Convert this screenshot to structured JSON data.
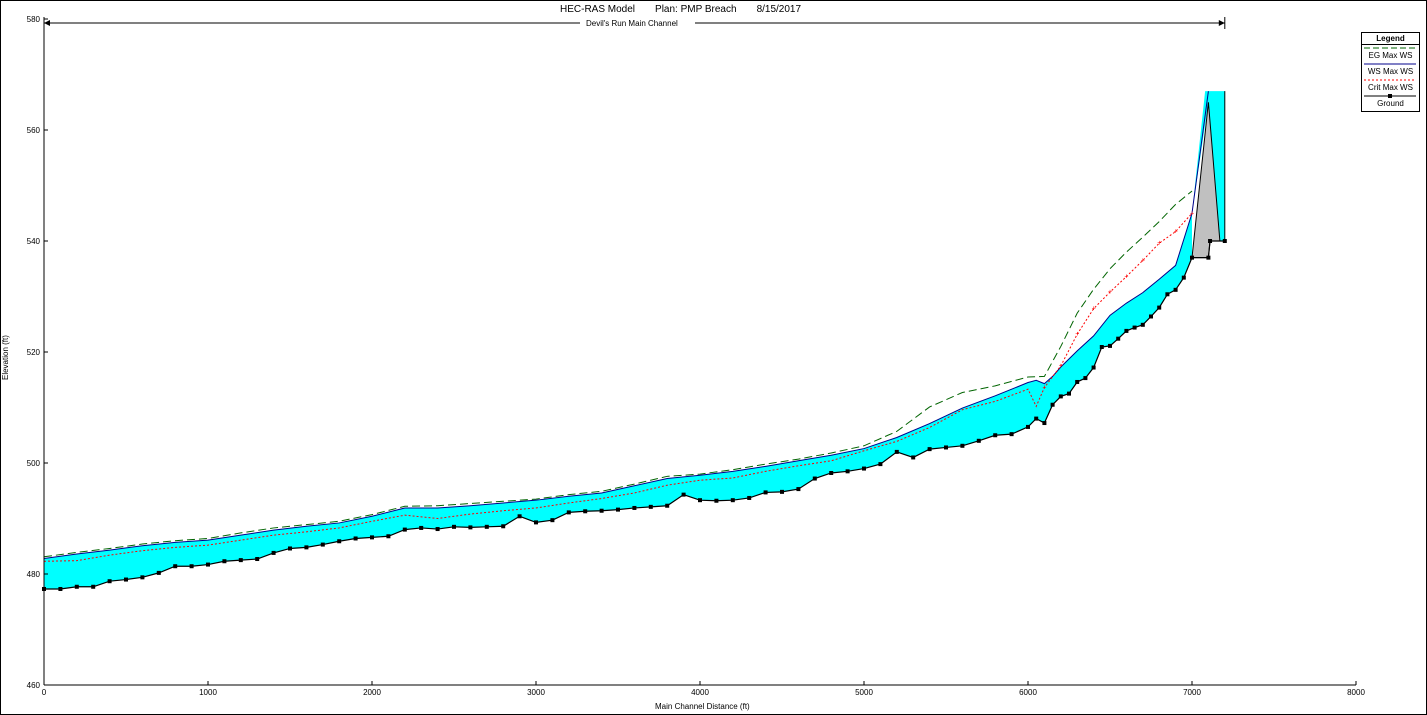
{
  "header": {
    "model": "HEC-RAS Model",
    "plan": "Plan: PMP Breach",
    "date": "8/15/2017",
    "reach": "Devil's Run Main Channel"
  },
  "legend": {
    "title": "Legend",
    "items": [
      {
        "label": "EG  Max WS",
        "color": "#006400",
        "style": "dashed"
      },
      {
        "label": "WS  Max WS",
        "color": "#00008b",
        "style": "solid"
      },
      {
        "label": "Crit  Max WS",
        "color": "#ff0000",
        "style": "dotted"
      },
      {
        "label": "Ground",
        "color": "#000000",
        "style": "solid-markers"
      }
    ]
  },
  "colors": {
    "water": "#00ffff",
    "structure": "#c0c0c0"
  },
  "chart_data": {
    "type": "line",
    "xlabel": "Main Channel Distance (ft)",
    "ylabel": "Elevation (ft)",
    "xlim": [
      0,
      8000
    ],
    "ylim": [
      460,
      580
    ],
    "xticks": [
      0,
      1000,
      2000,
      3000,
      4000,
      5000,
      6000,
      7000,
      8000
    ],
    "yticks": [
      460,
      480,
      500,
      520,
      540,
      560,
      580
    ],
    "grid": false,
    "legend_position": "top-right",
    "reach_extent": [
      0,
      7200
    ],
    "structure": {
      "type": "dam",
      "x": [
        7000,
        7200
      ],
      "crest": 567,
      "top_wall": [
        7100,
        567
      ]
    },
    "series": [
      {
        "name": "Ground",
        "x": [
          0,
          100,
          200,
          300,
          400,
          500,
          600,
          700,
          800,
          900,
          1000,
          1100,
          1200,
          1300,
          1400,
          1500,
          1600,
          1700,
          1800,
          1900,
          2000,
          2100,
          2200,
          2300,
          2400,
          2500,
          2600,
          2700,
          2800,
          2900,
          3000,
          3100,
          3200,
          3300,
          3400,
          3500,
          3600,
          3700,
          3800,
          3900,
          4000,
          4100,
          4200,
          4300,
          4400,
          4500,
          4600,
          4700,
          4800,
          4900,
          5000,
          5100,
          5200,
          5300,
          5400,
          5500,
          5600,
          5700,
          5800,
          5900,
          6000,
          6050,
          6100,
          6150,
          6200,
          6250,
          6300,
          6350,
          6400,
          6450,
          6500,
          6550,
          6600,
          6650,
          6700,
          6750,
          6800,
          6850,
          6900,
          6950,
          7000,
          7100,
          7110,
          7200
        ],
        "values": [
          477.3,
          477.3,
          477.7,
          477.7,
          478.7,
          479.0,
          479.4,
          480.2,
          481.4,
          481.4,
          481.7,
          482.3,
          482.5,
          482.7,
          483.8,
          484.6,
          484.8,
          485.3,
          485.9,
          486.4,
          486.6,
          486.8,
          488.0,
          488.3,
          488.1,
          488.5,
          488.4,
          488.5,
          488.6,
          490.4,
          489.3,
          489.7,
          491.1,
          491.3,
          491.4,
          491.6,
          491.9,
          492.1,
          492.3,
          494.3,
          493.3,
          493.2,
          493.3,
          493.7,
          494.7,
          494.8,
          495.3,
          497.2,
          498.2,
          498.5,
          499.0,
          499.8,
          502.0,
          501.0,
          502.5,
          502.8,
          503.1,
          504.0,
          505.0,
          505.2,
          506.5,
          508.0,
          507.2,
          510.5,
          512.0,
          512.5,
          514.6,
          515.3,
          517.2,
          520.9,
          521.1,
          522.4,
          523.8,
          524.4,
          524.9,
          526.4,
          528.0,
          530.4,
          531.2,
          533.4,
          537.0,
          537.0,
          540.0,
          540.0
        ]
      },
      {
        "name": "WS  Max WS",
        "x": [
          0,
          200,
          400,
          600,
          800,
          1000,
          1200,
          1400,
          1600,
          1800,
          2000,
          2200,
          2400,
          2600,
          2800,
          3000,
          3200,
          3400,
          3600,
          3800,
          4000,
          4200,
          4400,
          4600,
          4800,
          5000,
          5200,
          5400,
          5600,
          5800,
          6000,
          6050,
          6100,
          6150,
          6200,
          6300,
          6400,
          6500,
          6600,
          6700,
          6800,
          6900,
          7000,
          7100
        ],
        "values": [
          482.8,
          483.6,
          484.3,
          485.1,
          485.7,
          486.1,
          487.0,
          487.9,
          488.6,
          489.2,
          490.4,
          491.9,
          491.9,
          492.3,
          492.8,
          493.3,
          494.0,
          494.6,
          495.9,
          497.2,
          497.8,
          498.5,
          499.4,
          500.4,
          501.4,
          502.6,
          504.6,
          507.1,
          509.9,
          512.1,
          514.5,
          514.9,
          514.3,
          515.6,
          517.3,
          520.2,
          522.9,
          526.6,
          528.8,
          530.7,
          533.1,
          535.6,
          545.0,
          567.0
        ]
      },
      {
        "name": "Crit  Max WS",
        "x": [
          0,
          200,
          400,
          600,
          800,
          1000,
          1200,
          1400,
          1600,
          1800,
          2000,
          2200,
          2400,
          2600,
          2800,
          3000,
          3200,
          3400,
          3600,
          3800,
          4000,
          4200,
          4400,
          4600,
          4800,
          5000,
          5200,
          5400,
          5600,
          5800,
          6000,
          6050,
          6100,
          6200,
          6300,
          6400,
          6500,
          6600,
          6700,
          6800,
          6900,
          7000
        ],
        "values": [
          482.3,
          482.4,
          483.4,
          484.2,
          484.8,
          485.2,
          486.1,
          487.0,
          487.6,
          488.3,
          489.5,
          490.6,
          490.0,
          490.8,
          491.4,
          491.9,
          492.8,
          493.6,
          494.6,
          496.0,
          496.9,
          497.3,
          498.5,
          499.5,
          500.4,
          502.2,
          503.9,
          506.4,
          509.6,
          511.1,
          513.3,
          510.2,
          513.6,
          517.5,
          523.2,
          527.8,
          530.8,
          533.6,
          536.5,
          539.6,
          541.7,
          545.0
        ]
      },
      {
        "name": "EG  Max WS",
        "x": [
          0,
          200,
          400,
          600,
          800,
          1000,
          1200,
          1400,
          1600,
          1800,
          2000,
          2200,
          2400,
          2600,
          2800,
          3000,
          3200,
          3400,
          3600,
          3800,
          4000,
          4200,
          4400,
          4600,
          4800,
          5000,
          5200,
          5400,
          5600,
          5800,
          6000,
          6100,
          6200,
          6300,
          6400,
          6500,
          6600,
          6700,
          6800,
          6900,
          7000
        ],
        "values": [
          483.1,
          483.9,
          484.6,
          485.4,
          486.0,
          486.4,
          487.4,
          488.3,
          488.9,
          489.5,
          490.7,
          492.2,
          492.3,
          492.7,
          493.1,
          493.5,
          494.3,
          494.9,
          496.2,
          497.6,
          498.0,
          498.8,
          499.8,
          500.7,
          501.8,
          503.1,
          505.7,
          510.1,
          512.7,
          513.9,
          515.5,
          515.6,
          521.0,
          527.0,
          531.3,
          535.0,
          538.0,
          540.7,
          543.5,
          546.6,
          549.0
        ]
      }
    ]
  }
}
